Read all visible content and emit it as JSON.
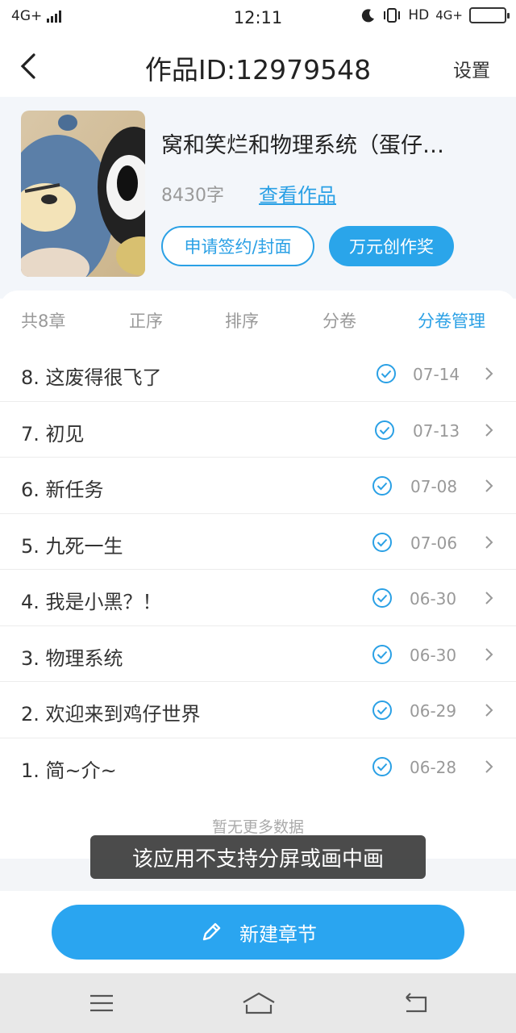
{
  "status_bar": {
    "network": "4G+",
    "time": "12:11",
    "right_text": "HD",
    "right_network": "4G+",
    "battery_color": "#f5c400"
  },
  "header": {
    "title": "作品ID:12979548",
    "settings_label": "设置",
    "back_icon": "chevron-left-icon"
  },
  "work": {
    "title": "窝和笑烂和物理系统（蛋仔…",
    "word_count": "8430字",
    "view_link": "查看作品",
    "sign_button": "申请签约/封面",
    "award_button": "万元创作奖"
  },
  "tabs": [
    {
      "label": "共8章",
      "active": false
    },
    {
      "label": "正序",
      "active": false
    },
    {
      "label": "排序",
      "active": false
    },
    {
      "label": "分卷",
      "active": false
    },
    {
      "label": "分卷管理",
      "active": true
    }
  ],
  "chapters": [
    {
      "title": "8. 这废得很飞了",
      "date": "07-14"
    },
    {
      "title": "7. 初见",
      "date": "07-13"
    },
    {
      "title": "6. 新任务",
      "date": "07-08"
    },
    {
      "title": "5. 九死一生",
      "date": "07-06"
    },
    {
      "title": "4. 我是小黑？！",
      "date": "06-30"
    },
    {
      "title": "3. 物理系统",
      "date": "06-30"
    },
    {
      "title": "2. 欢迎来到鸡仔世界",
      "date": "06-29"
    },
    {
      "title": "1. 简~介~",
      "date": "06-28"
    }
  ],
  "footer": {
    "no_more": "暂无更多数据",
    "toast": "该应用不支持分屏或画中画",
    "new_chapter_label": "新建章节"
  },
  "colors": {
    "accent": "#2aa0e5",
    "button_fill": "#2aa5ea"
  }
}
